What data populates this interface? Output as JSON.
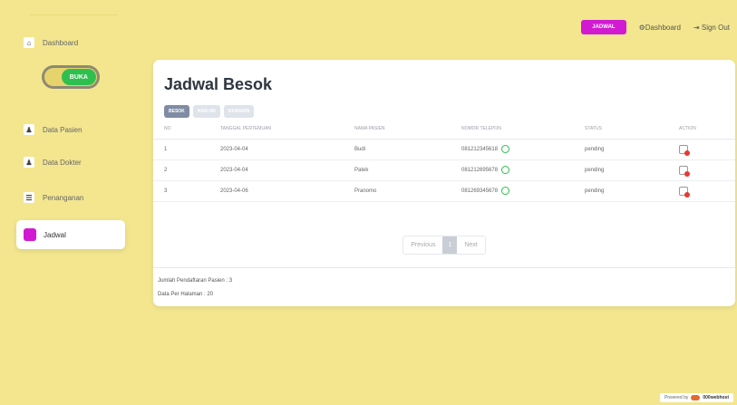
{
  "sidebar": {
    "items": [
      {
        "label": "Dashboard",
        "icon": "home-icon"
      },
      {
        "label": "Data Pasien",
        "icon": "users-icon"
      },
      {
        "label": "Data Dokter",
        "icon": "users-icon"
      },
      {
        "label": "Penanganan",
        "icon": "list-icon"
      },
      {
        "label": "Jadwal",
        "icon": "calendar-icon"
      }
    ],
    "toggle_label": "BUKA"
  },
  "topbar": {
    "jadwal_button": "JADWAL",
    "dashboard_link": "Dashboard",
    "signout_link": "Sign Out"
  },
  "card": {
    "title": "Jadwal Besok",
    "tabs": [
      "BESOK",
      "HARI INI",
      "KEMARIN"
    ],
    "columns": [
      "NO",
      "TANGGAL PERTEMUAN",
      "NAMA PASIEN",
      "NOMOR TELEPON",
      "STATUS",
      "ACTION"
    ],
    "rows": [
      {
        "no": "1",
        "tanggal": "2023-04-04",
        "nama": "Budi",
        "telepon": "081212345618",
        "status": "pending"
      },
      {
        "no": "2",
        "tanggal": "2023-04-04",
        "nama": "Patek",
        "telepon": "081212695678",
        "status": "pending"
      },
      {
        "no": "3",
        "tanggal": "2023-04-06",
        "nama": "Pranomo",
        "telepon": "081269345678",
        "status": "pending"
      }
    ],
    "pagination": {
      "previous": "Previous",
      "page": "1",
      "next": "Next"
    },
    "footer_total": "Jumlah Pendaftaran Pasien : 3",
    "footer_per_page": "Data Per Halaman : 20"
  },
  "powered_by": {
    "prefix": "Powered by",
    "brand": "000webhost"
  },
  "colors": {
    "background": "#f3e68f",
    "accent": "#d21ad2",
    "toggle": "#2fbf4f",
    "whatsapp": "#2fbf4f"
  }
}
